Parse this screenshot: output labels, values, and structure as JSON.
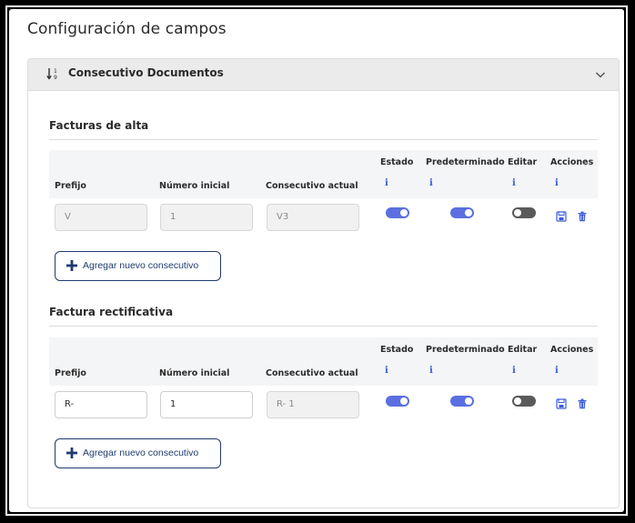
{
  "page_title": "Configuración de campos",
  "accordion": {
    "title": "Consecutivo Documentos",
    "icon": "sort-numeric-icon"
  },
  "columns": {
    "prefijo": "Prefijo",
    "numero_inicial": "Número inicial",
    "consecutivo_actual": "Consecutivo actual",
    "estado": "Estado",
    "predeterminado": "Predeterminado",
    "editar": "Editar",
    "acciones": "Acciones",
    "info_glyph": "i"
  },
  "sections": [
    {
      "title": "Facturas de alta",
      "row": {
        "prefijo": "V",
        "numero_inicial": "1",
        "consecutivo_actual": "V3",
        "estado": true,
        "predeterminado": true,
        "editar": false
      },
      "add_button": "Agregar nuevo consecutivo"
    },
    {
      "title": "Factura rectificativa",
      "row": {
        "prefijo": "R-",
        "numero_inicial": "1",
        "consecutivo_actual": "R- 1",
        "estado": true,
        "predeterminado": true,
        "editar": false
      },
      "add_button": "Agregar nuevo consecutivo"
    }
  ],
  "colors": {
    "accent": "#5b6fe0",
    "info": "#3b5bdb",
    "button_border": "#1f3b6e",
    "toggle_off": "#5a5a5a"
  }
}
